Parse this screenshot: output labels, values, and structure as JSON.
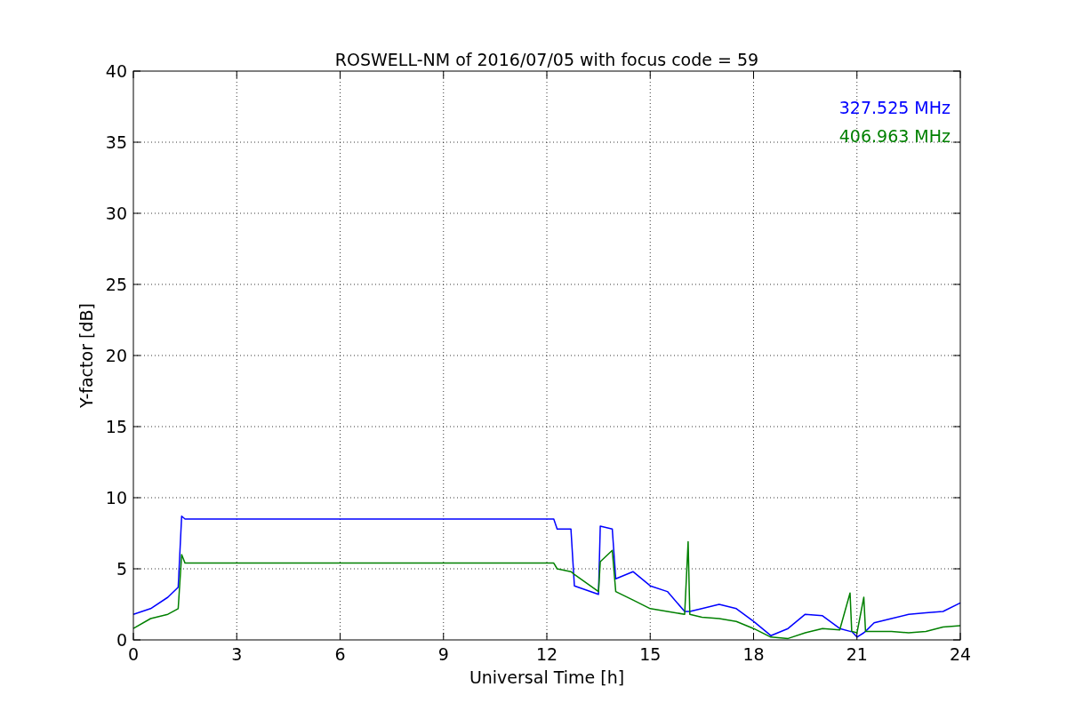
{
  "chart_data": {
    "type": "line",
    "title": "ROSWELL-NM of 2016/07/05 with focus code = 59",
    "xlabel": "Universal Time [h]",
    "ylabel": "Y-factor [dB]",
    "x": [
      0,
      0.5,
      1,
      1.3,
      1.4,
      1.5,
      12.2,
      12.3,
      12.7,
      12.8,
      13.5,
      13.55,
      13.9,
      14,
      14.5,
      15,
      15.5,
      16,
      16.1,
      16.15,
      16.5,
      17,
      17.5,
      18,
      18.5,
      19,
      19.5,
      20,
      20.5,
      20.8,
      20.85,
      21,
      21.2,
      21.25,
      21.5,
      22,
      22.5,
      23,
      23.5,
      24
    ],
    "series": [
      {
        "name": "327.525 MHz",
        "color": "#0000ff",
        "values": [
          1.8,
          2.2,
          3.0,
          3.7,
          8.7,
          8.5,
          8.5,
          7.8,
          7.8,
          3.8,
          3.2,
          8.0,
          7.8,
          4.3,
          4.8,
          3.8,
          3.4,
          2.0,
          2.0,
          2.0,
          2.2,
          2.5,
          2.2,
          1.3,
          0.3,
          0.8,
          1.8,
          1.7,
          0.8,
          0.6,
          0.6,
          0.2,
          0.5,
          0.6,
          1.2,
          1.5,
          1.8,
          1.9,
          2.0,
          2.6
        ]
      },
      {
        "name": "406.963 MHz",
        "color": "#008000",
        "values": [
          0.8,
          1.5,
          1.8,
          2.2,
          6.0,
          5.4,
          5.4,
          5.0,
          4.8,
          4.6,
          3.4,
          5.5,
          6.3,
          3.4,
          2.8,
          2.2,
          2.0,
          1.8,
          6.9,
          1.8,
          1.6,
          1.5,
          1.3,
          0.8,
          0.2,
          0.1,
          0.5,
          0.8,
          0.7,
          3.3,
          0.6,
          0.5,
          3.0,
          0.6,
          0.6,
          0.6,
          0.5,
          0.6,
          0.9,
          1.0
        ]
      }
    ],
    "xlim": [
      0,
      24
    ],
    "ylim": [
      0,
      40
    ],
    "xticks": [
      0,
      3,
      6,
      9,
      12,
      15,
      18,
      21,
      24
    ],
    "yticks": [
      0,
      5,
      10,
      15,
      20,
      25,
      30,
      35,
      40
    ],
    "grid": true
  }
}
